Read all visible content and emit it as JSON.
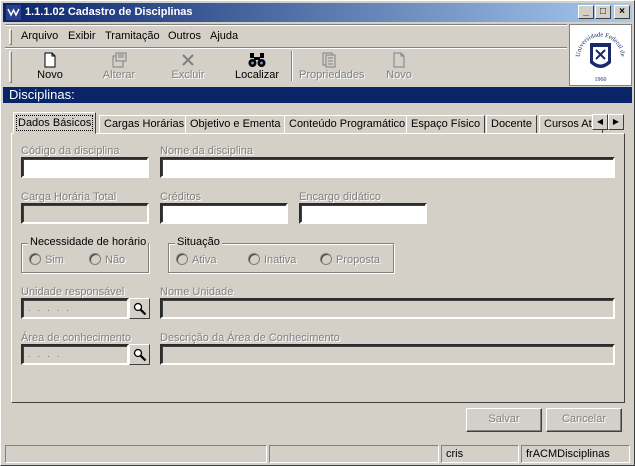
{
  "window": {
    "title": "1.1.1.02 Cadastro de Disciplinas",
    "controls": [
      "_",
      "□",
      "×"
    ]
  },
  "menu": [
    {
      "label": "Arquivo"
    },
    {
      "label": "Exibir"
    },
    {
      "label": "Tramitação"
    },
    {
      "label": "Outros"
    },
    {
      "label": "Ajuda"
    }
  ],
  "toolbar": {
    "novo": "Novo",
    "alterar": "Alterar",
    "excluir": "Excluir",
    "localizar": "Localizar",
    "propriedades": "Propriedades",
    "novo2": "Novo"
  },
  "logo": {
    "text": "Universidade Federal de Santa Maria",
    "year": "1960"
  },
  "section_title": "Disciplinas:",
  "tabs": [
    "Dados Básicos",
    "Cargas Horárias",
    "Objetivo e Ementa",
    "Conteúdo Programático",
    "Espaço Físico",
    "Docente",
    "Cursos Ate"
  ],
  "form": {
    "codigo_label": "Código da disciplina",
    "codigo_value": "",
    "nome_label": "Nome da disciplina",
    "nome_value": "",
    "carga_label": "Carga Horária Total",
    "carga_value": "",
    "creditos_label": "Créditos",
    "creditos_value": "",
    "encargo_label": "Encargo didático",
    "encargo_value": "",
    "necessidade_title": "Necessidade de horário",
    "necessidade_options": [
      "Sim",
      "Não"
    ],
    "situacao_title": "Situação",
    "situacao_options": [
      "Ativa",
      "Inativa",
      "Proposta"
    ],
    "unidade_label": "Unidade responsável",
    "unidade_mask": ". . . . .",
    "nome_unidade_label": "Nome Unidade",
    "nome_unidade_value": "",
    "area_label": "Área de conhecimento",
    "area_mask": ". . . .",
    "desc_area_label": "Descrição da Área de Conhecimento",
    "desc_area_value": ""
  },
  "buttons": {
    "salvar": "Salvar",
    "cancelar": "Cancelar"
  },
  "statusbar": {
    "panel1": "",
    "panel2": "",
    "user": "cris",
    "form_name": "frACMDisciplinas"
  },
  "colors": {
    "titlebar_start": "#0a246a",
    "titlebar_end": "#a6caf0",
    "section_bg": "#0a246a",
    "face": "#d4d0c8"
  }
}
